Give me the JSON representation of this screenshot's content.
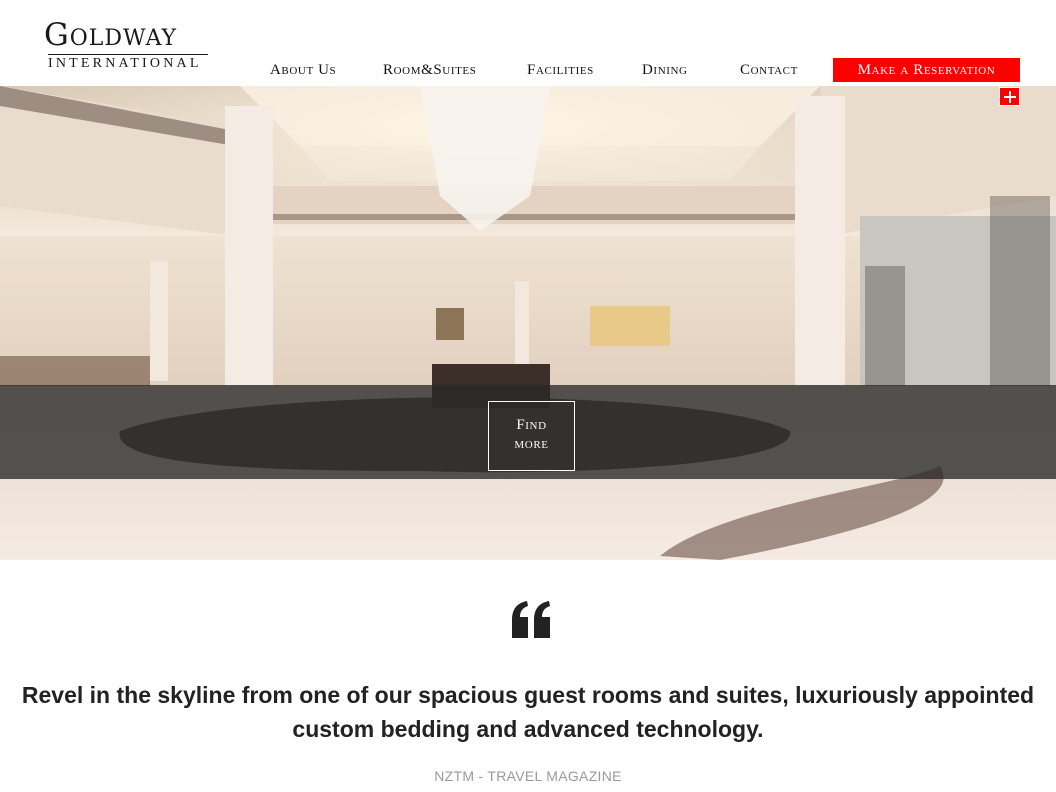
{
  "brand": {
    "name": "Goldway",
    "subtitle": "INTERNATIONAL"
  },
  "nav": {
    "items": [
      {
        "label": "About Us"
      },
      {
        "label": "Room&Suites"
      },
      {
        "label": "Facilities"
      },
      {
        "label": "Dining"
      },
      {
        "label": "Contact"
      }
    ],
    "reservation_label": "Make a Reservation"
  },
  "hero": {
    "cta_line1": "Find",
    "cta_line2": "more",
    "plus_icon": "plus-icon"
  },
  "testimonial": {
    "quote_icon": "quote-icon",
    "text": "Revel in the skyline from one of our spacious guest rooms and suites, luxuriously appointed custom bedding and advanced technology.",
    "source": "NZTM - TRAVEL MAGAZINE"
  },
  "colors": {
    "accent": "#ff0000",
    "text": "#222222",
    "muted": "#9a9a9a"
  }
}
